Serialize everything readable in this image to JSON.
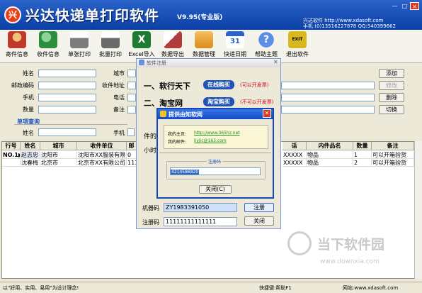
{
  "app": {
    "logo_char": "兴",
    "title": "兴达快递单打印软件",
    "version": "V9.95(专业版)",
    "site_line": "兴达软件  http://www.xdasoft.com",
    "phone_line": "手机:(0)13516227878 QQ:540399662",
    "window_buttons": [
      "—",
      "□",
      "✕"
    ]
  },
  "toolbar": {
    "items": [
      {
        "label": "寄件信息",
        "icon": "sender-info-icon",
        "color": "#c0392b"
      },
      {
        "label": "收件信息",
        "icon": "recipient-info-icon",
        "color": "#2b8e3e"
      },
      {
        "label": "单张打印",
        "icon": "printer-icon",
        "color": "#7d7d7d"
      },
      {
        "label": "批量打印",
        "icon": "batch-printer-icon",
        "color": "#6a6a6a"
      },
      {
        "label": "Excel导入",
        "icon": "excel-icon",
        "color": "#1e7b34"
      },
      {
        "label": "数据导出",
        "icon": "export-icon",
        "color": "#b23b3b"
      },
      {
        "label": "数据管理",
        "icon": "box-icon",
        "color": "#d98b1d"
      },
      {
        "label": "快递日期",
        "icon": "calendar-icon",
        "color": "#2a63c9"
      },
      {
        "label": "帮助主题",
        "icon": "help-icon",
        "color": "#3a6fd1"
      },
      {
        "label": "退出软件",
        "icon": "exit-icon",
        "color": "#d8b81c"
      }
    ]
  },
  "form": {
    "name_label": "姓名",
    "city_label": "城市",
    "zip_label": "邮政编码",
    "address_label": "收件地址",
    "phone_label": "手机",
    "tel_label": "电话",
    "qty_label": "数量",
    "note_label": "备注",
    "btn_add": "添加",
    "btn_modify": "修改",
    "btn_delete": "删除",
    "btn_switch": "切换"
  },
  "query": {
    "section_title": "单项查询",
    "name_label": "姓名",
    "phone_label": "手机"
  },
  "table": {
    "headers": [
      "行号",
      "姓名",
      "城市",
      "收件单位",
      "邮",
      "话",
      "内件品名",
      "数量",
      "备注"
    ],
    "rows": [
      {
        "no": "NO.1▶",
        "name": "赵志忠",
        "city": "沈阳市",
        "unit": "沈阳市XX服装有限",
        "zip": "0",
        "tel": "XXXXX",
        "item": "物品",
        "qty": "1",
        "note": "可以开箱验货"
      },
      {
        "no": "",
        "name": "沈春梅",
        "city": "北京市",
        "unit": "北京市XX有限公司",
        "zip": "111",
        "tel": "XXXXX",
        "item": "物品",
        "qty": "2",
        "note": "可以开箱验货"
      }
    ]
  },
  "register_dialog": {
    "title": "软件注册",
    "line1": "一、软行天下",
    "line1_btn": "在线购买",
    "line1_note": "(可以开发票)",
    "line2": "二、淘宝网",
    "line2_btn": "淘宝购买",
    "line2_note": "(不可以开发票)",
    "partial_text1": "件的",
    "partial_text2": "小时",
    "machine_label": "机器码",
    "machine_code": "ZY1983391050",
    "register_btn": "注册",
    "reg_label": "注册码",
    "reg_value": "11111111111111",
    "close_btn": "关闭"
  },
  "popup": {
    "title": "提供由知软网",
    "home_label": "我的主页:",
    "home_url": "http://www.365hz.net",
    "mail_label": "我的邮件:",
    "mail_value": "liyjic@163.com",
    "code_group": "注册码",
    "code_value": "4214586820",
    "close_btn": "关闭(C)"
  },
  "watermark": {
    "text": "当下软件园",
    "url": "www.downxia.com"
  },
  "status": {
    "left": "以\"好用、实用、易用\"为设计理念!",
    "middle": "快捷键:帮助F1",
    "right": "网站:www.xdasoft.com"
  }
}
